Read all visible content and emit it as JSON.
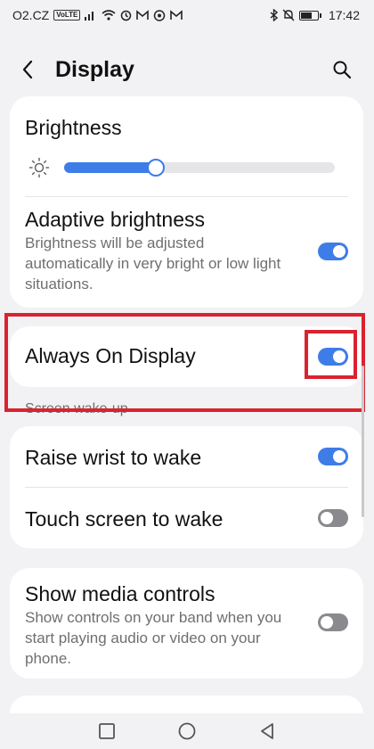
{
  "status_bar": {
    "carrier": "O2.CZ",
    "volte": "VoLTE",
    "time": "17:42"
  },
  "app_bar": {
    "title": "Display",
    "back_icon": "chevron-left-icon",
    "search_icon": "search-icon"
  },
  "brightness": {
    "title": "Brightness",
    "level_percent": 34,
    "icon": "sun-icon"
  },
  "adaptive_brightness": {
    "title": "Adaptive brightness",
    "description": "Brightness will be adjusted automatically in very bright or low light situations.",
    "enabled": true
  },
  "always_on_display": {
    "title": "Always On Display",
    "enabled": true
  },
  "screen_wake_up": {
    "header": "Screen wake-up",
    "items": [
      {
        "title": "Raise wrist to wake",
        "enabled": true
      },
      {
        "title": "Touch screen to wake",
        "enabled": false
      }
    ]
  },
  "show_media_controls": {
    "title": "Show media controls",
    "description": "Show controls on your band when you start playing audio or video on your phone.",
    "enabled": false
  },
  "colors": {
    "accent": "#3e7ce8",
    "toggle_off": "#8a8a8e",
    "highlight": "#d9232f",
    "background": "#f2f2f4"
  },
  "nav_bar": {
    "buttons": [
      "recents-square-icon",
      "home-circle-icon",
      "back-triangle-icon"
    ]
  }
}
